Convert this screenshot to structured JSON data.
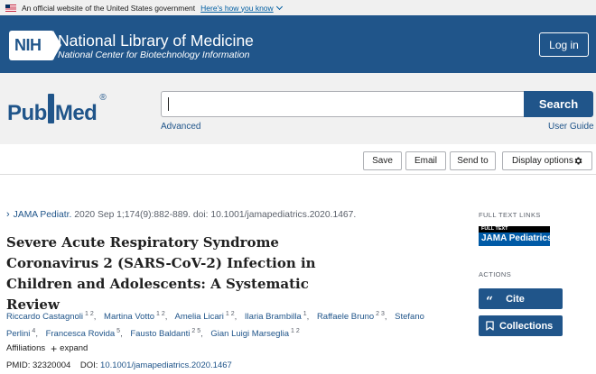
{
  "gov_banner": {
    "text": "An official website of the United States government",
    "link": "Here's how you know"
  },
  "nih_header": {
    "logo_text": "NIH",
    "title": "National Library of Medicine",
    "subtitle": "National Center for Biotechnology Information",
    "login_label": "Log in"
  },
  "search": {
    "logo_left": "Pub",
    "logo_right": "Med",
    "logo_mark": "®",
    "value": "",
    "button_label": "Search",
    "advanced_label": "Advanced",
    "user_guide_label": "User Guide"
  },
  "toolbar": {
    "save_label": "Save",
    "email_label": "Email",
    "send_to_label": "Send to",
    "display_label": "Display options"
  },
  "article": {
    "journal": "JAMA Pediatr.",
    "citation": "2020 Sep 1;174(9):882-889. doi: 10.1001/jamapediatrics.2020.1467.",
    "title": "Severe Acute Respiratory Syndrome Coronavirus 2 (SARS-CoV-2) Infection in Children and Adolescents: A Systematic Review",
    "authors": [
      {
        "name": "Riccardo Castagnoli",
        "sup": "1 2"
      },
      {
        "name": "Martina Votto",
        "sup": "1 2"
      },
      {
        "name": "Amelia Licari",
        "sup": "1 2"
      },
      {
        "name": "Ilaria Brambilla",
        "sup": "1"
      },
      {
        "name": "Raffaele Bruno",
        "sup": "2 3"
      },
      {
        "name": "Stefano Perlini",
        "sup": "4"
      },
      {
        "name": "Francesca Rovida",
        "sup": "5"
      },
      {
        "name": "Fausto Baldanti",
        "sup": "2 5"
      },
      {
        "name": "Gian Luigi Marseglia",
        "sup": "1 2"
      }
    ],
    "affiliations_label": "Affiliations",
    "expand_label": "expand",
    "pmid_label": "PMID: 32320004",
    "doi_label": "DOI:",
    "doi_value": "10.1001/jamapediatrics.2020.1467"
  },
  "sidebar": {
    "full_text_links_label": "FULL TEXT LINKS",
    "badge_top": "FULL TEXT",
    "badge_main": "JAMA Pediatrics",
    "actions_label": "ACTIONS",
    "cite_label": "Cite",
    "collections_label": "Collections"
  },
  "colors": {
    "nih_blue": "#20558a",
    "search_bg": "#f1f1f1",
    "link_blue": "#20558a",
    "jama_blue": "#005aa6"
  }
}
